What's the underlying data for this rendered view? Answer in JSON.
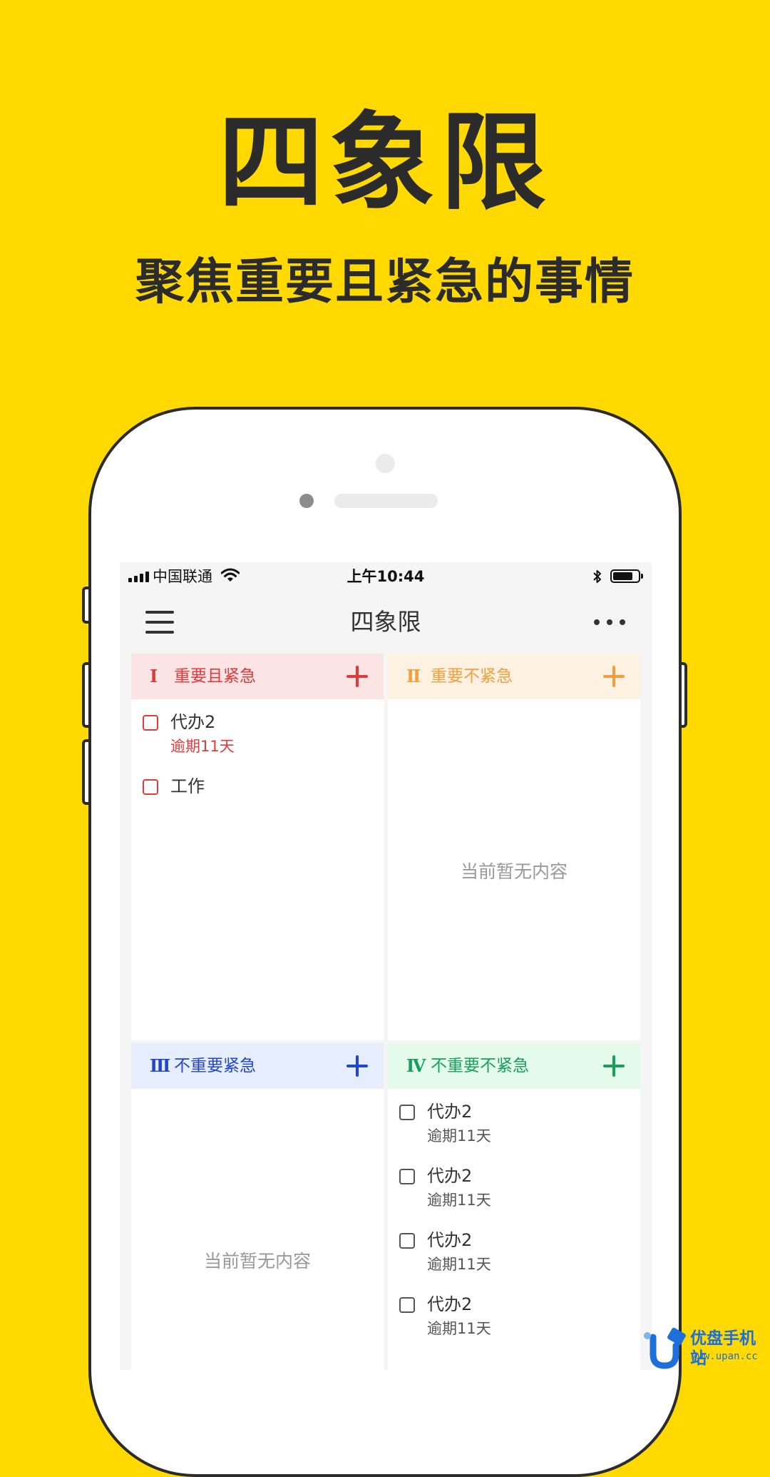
{
  "promo": {
    "title": "四象限",
    "subtitle": "聚焦重要且紧急的事情"
  },
  "status_bar": {
    "carrier": "中国联通",
    "time": "上午10:44",
    "battery_level": 0.78
  },
  "app_bar": {
    "title": "四象限",
    "menu_icon": "hamburger-menu-icon",
    "more_icon": "more-dots-icon"
  },
  "colors": {
    "background": "#FFD900",
    "q1": "#E03A3A",
    "q1_bg": "#FCE4E4",
    "q2": "#F2A03D",
    "q2_bg": "#FDF1E1",
    "q3": "#2145D0",
    "q3_bg": "#E6EDFC",
    "q4": "#16A05A",
    "q4_bg": "#E4FBEC"
  },
  "quadrants": [
    {
      "numeral": "Ⅰ",
      "label": "重要且紧急",
      "empty_text": "",
      "tasks": [
        {
          "title": "代办2",
          "due": "逾期11天"
        },
        {
          "title": "工作",
          "due": ""
        }
      ]
    },
    {
      "numeral": "Ⅱ",
      "label": "重要不紧急",
      "empty_text": "当前暂无内容",
      "tasks": []
    },
    {
      "numeral": "Ⅲ",
      "label": "不重要紧急",
      "empty_text": "当前暂无内容",
      "tasks": []
    },
    {
      "numeral": "Ⅳ",
      "label": "不重要不紧急",
      "empty_text": "",
      "tasks": [
        {
          "title": "代办2",
          "due": "逾期11天"
        },
        {
          "title": "代办2",
          "due": "逾期11天"
        },
        {
          "title": "代办2",
          "due": "逾期11天"
        },
        {
          "title": "代办2",
          "due": "逾期11天"
        }
      ]
    }
  ],
  "watermark": {
    "name": "优盘手机站",
    "url": "www.upan.cc"
  }
}
